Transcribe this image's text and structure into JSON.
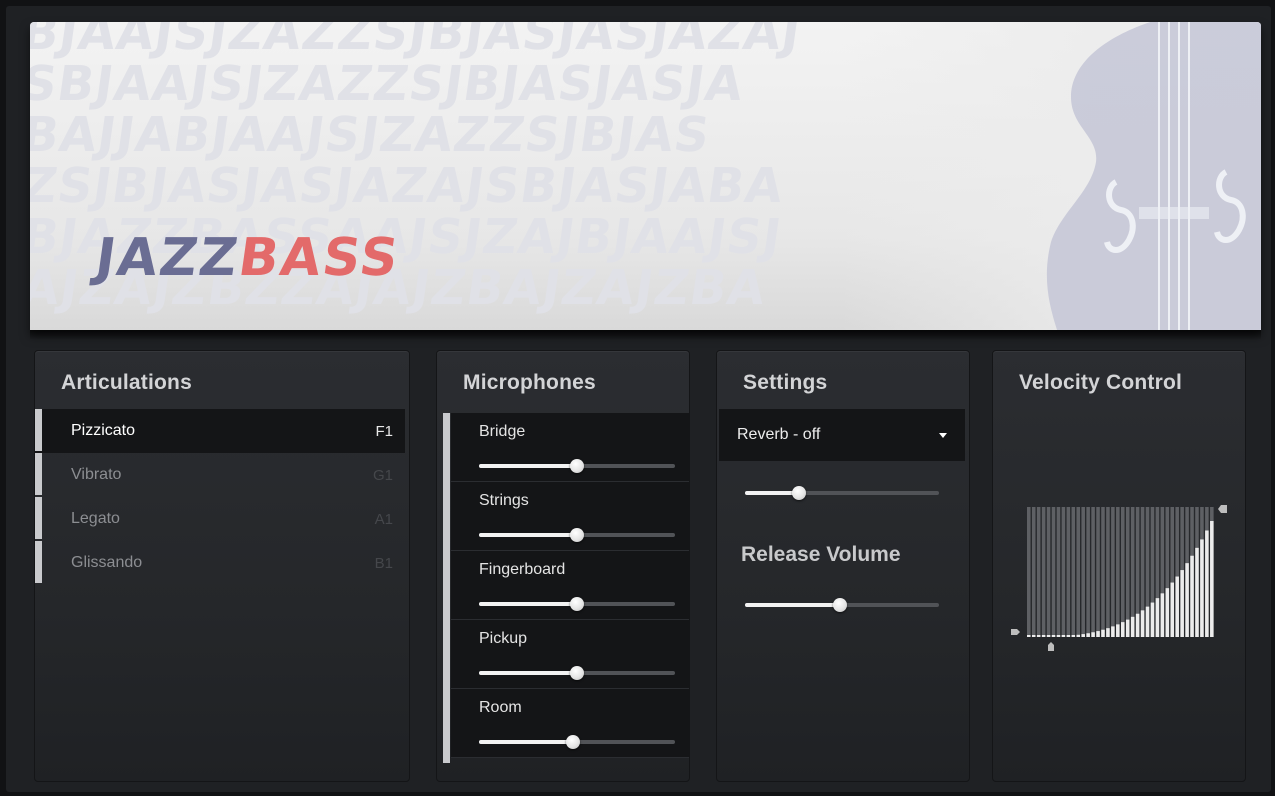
{
  "banner": {
    "letters": [
      "BJAAJSJZAZZSJBJASJASJAZAJ",
      "SBJAAJSJZAZZSJBJASJASJA",
      "BAJJABJAAJSJZAZZSJBJAS",
      "ZSJBJASJASJAZAJSBJASJABA",
      "BJAZZBASSAAJSJZAJBJAAJSJ",
      "AJZAJZBZZAJAJZBAJZAJZBA"
    ],
    "logo_part1": "JAZZ",
    "logo_part2": "BASS"
  },
  "articulations": {
    "title": "Articulations",
    "items": [
      {
        "name": "Pizzicato",
        "key": "F1",
        "active": true
      },
      {
        "name": "Vibrato",
        "key": "G1",
        "active": false
      },
      {
        "name": "Legato",
        "key": "A1",
        "active": false
      },
      {
        "name": "Glissando",
        "key": "B1",
        "active": false
      }
    ]
  },
  "microphones": {
    "title": "Microphones",
    "channels": [
      {
        "label": "Bridge",
        "level": 0.5
      },
      {
        "label": "Strings",
        "level": 0.5
      },
      {
        "label": "Fingerboard",
        "level": 0.5
      },
      {
        "label": "Pickup",
        "level": 0.5
      },
      {
        "label": "Room",
        "level": 0.48
      }
    ]
  },
  "settings": {
    "title": "Settings",
    "reverb_select": "Reverb - off",
    "reverb_level": 0.28,
    "release_title": "Release Volume",
    "release_level": 0.49
  },
  "velocity": {
    "title": "Velocity Control",
    "curve_exponent": 3.2
  },
  "colors": {
    "logo_jazz": "#6a6d93",
    "logo_bass": "#e36a6a",
    "panel_bg": "#25272a",
    "highlight_bar": "#c9cacd"
  }
}
